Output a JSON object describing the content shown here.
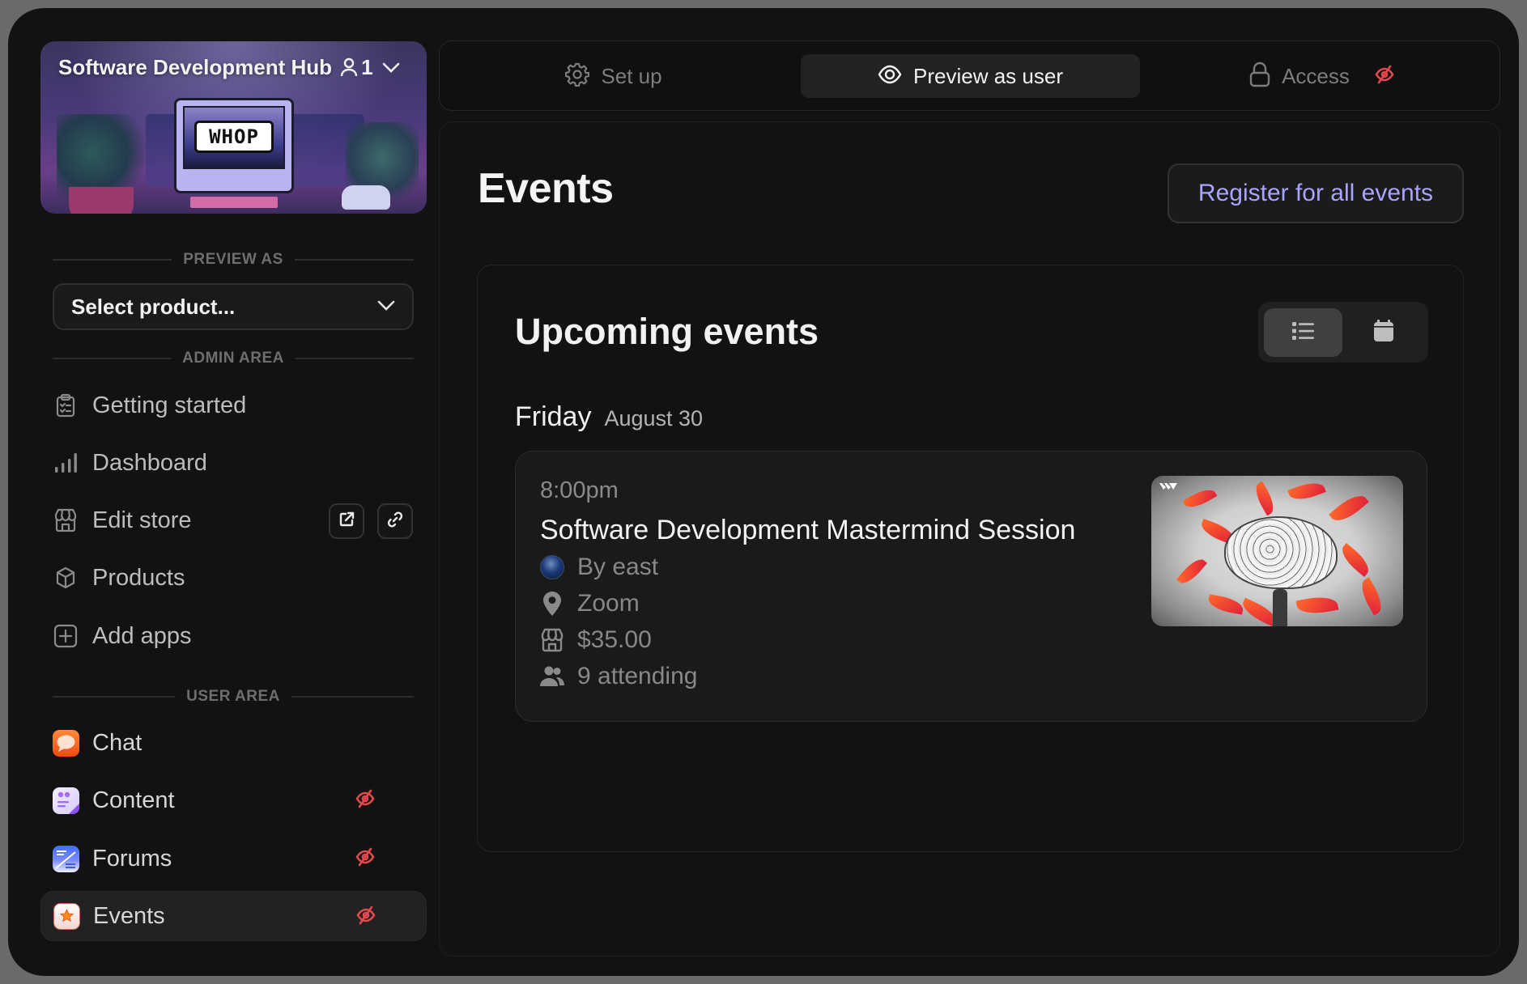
{
  "store": {
    "name": "Software Development Hub",
    "member_count": "1",
    "icons": {
      "members": "person-icon",
      "expand": "chevron-down-icon"
    },
    "banner_text": "WHOP"
  },
  "sidebar": {
    "preview_as_label": "PREVIEW AS",
    "select_product": {
      "value": "Select product...",
      "icon": "chevron-down-icon"
    },
    "admin_area_label": "ADMIN AREA",
    "admin_items": [
      {
        "label": "Getting started",
        "icon": "clipboard-checklist-icon"
      },
      {
        "label": "Dashboard",
        "icon": "bar-chart-icon"
      },
      {
        "label": "Edit store",
        "icon": "storefront-icon",
        "actions": [
          "external-link-icon",
          "link-icon"
        ]
      },
      {
        "label": "Products",
        "icon": "cube-icon"
      },
      {
        "label": "Add apps",
        "icon": "plus-square-icon"
      }
    ],
    "user_area_label": "USER AREA",
    "user_items": [
      {
        "label": "Chat",
        "icon": "chat-app-icon",
        "hidden": false,
        "active": false
      },
      {
        "label": "Content",
        "icon": "content-app-icon",
        "hidden": true,
        "active": false
      },
      {
        "label": "Forums",
        "icon": "forums-app-icon",
        "hidden": true,
        "active": false
      },
      {
        "label": "Events",
        "icon": "events-app-icon",
        "hidden": true,
        "active": true
      }
    ]
  },
  "tabs": [
    {
      "label": "Set up",
      "icon": "gear-icon",
      "active": false
    },
    {
      "label": "Preview as user",
      "icon": "eye-icon",
      "active": true
    },
    {
      "label": "Access",
      "icon": "lock-icon",
      "active": false,
      "badge_icon": "eye-off-icon"
    }
  ],
  "main": {
    "title": "Events",
    "register_button": "Register for all events",
    "upcoming": {
      "title": "Upcoming events",
      "view_toggle": [
        {
          "icon": "list-icon",
          "active": true
        },
        {
          "icon": "calendar-icon",
          "active": false
        }
      ],
      "days": [
        {
          "day": "Friday",
          "date": "August 30",
          "events": [
            {
              "time": "8:00pm",
              "title": "Software Development Mastermind Session",
              "host": "By east",
              "location": "Zoom",
              "price": "$35.00",
              "attending": "9 attending"
            }
          ]
        }
      ]
    }
  },
  "colors": {
    "accent": "#a8a4ff",
    "hidden_indicator": "#e5484d",
    "background": "#121212",
    "frame": "#6a6a6a"
  }
}
